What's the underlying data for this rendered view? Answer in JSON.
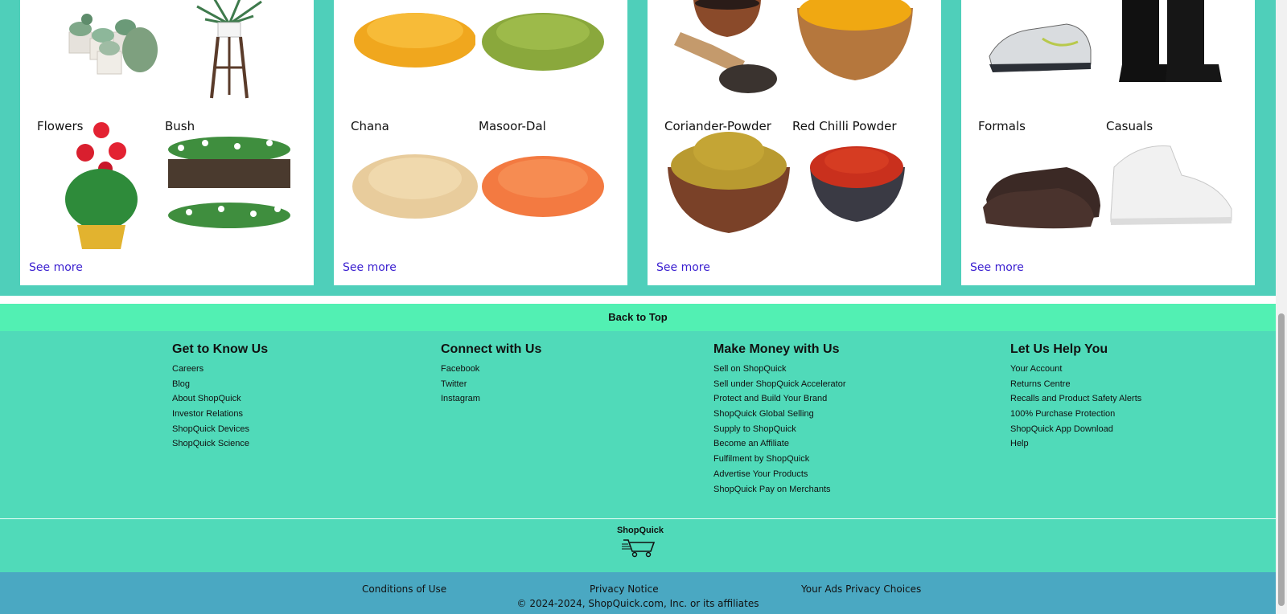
{
  "cards": [
    {
      "items": [
        {
          "label": "",
          "icon": "succulents-image"
        },
        {
          "label": "",
          "icon": "plant-stand-image"
        },
        {
          "label": "Flowers",
          "icon": "flowers-image"
        },
        {
          "label": "Bush",
          "icon": "bush-image"
        }
      ],
      "see_more": "See more"
    },
    {
      "items": [
        {
          "label": "",
          "icon": "yellow-lentils-image"
        },
        {
          "label": "",
          "icon": "green-gram-image"
        },
        {
          "label": "Chana",
          "icon": "chana-image"
        },
        {
          "label": "Masoor-Dal",
          "icon": "masoor-dal-image"
        }
      ],
      "see_more": "See more"
    },
    {
      "items": [
        {
          "label": "",
          "icon": "pepper-image"
        },
        {
          "label": "",
          "icon": "turmeric-image"
        },
        {
          "label": "Coriander-Powder",
          "icon": "coriander-powder-image"
        },
        {
          "label": "Red Chilli Powder",
          "icon": "red-chilli-powder-image"
        }
      ],
      "see_more": "See more"
    },
    {
      "items": [
        {
          "label": "",
          "icon": "sneakers-image"
        },
        {
          "label": "",
          "icon": "boots-image"
        },
        {
          "label": "Formals",
          "icon": "formal-shoes-image"
        },
        {
          "label": "Casuals",
          "icon": "casual-shoes-image"
        }
      ],
      "see_more": "See more"
    }
  ],
  "back_to_top": "Back to Top",
  "footer": {
    "columns": [
      {
        "title": "Get to Know Us",
        "links": [
          "Careers",
          "Blog",
          "About ShopQuick",
          "Investor Relations",
          "ShopQuick Devices",
          "ShopQuick Science"
        ]
      },
      {
        "title": "Connect with Us",
        "links": [
          "Facebook",
          "Twitter",
          "Instagram"
        ]
      },
      {
        "title": "Make Money with Us",
        "links": [
          "Sell on ShopQuick",
          "Sell under ShopQuick Accelerator",
          "Protect and Build Your Brand",
          "ShopQuick Global Selling",
          "Supply to ShopQuick",
          "Become an Affiliate",
          "Fulfilment by ShopQuick",
          "Advertise Your Products",
          "ShopQuick Pay on Merchants"
        ]
      },
      {
        "title": "Let Us Help You",
        "links": [
          "Your Account",
          "Returns Centre",
          "Recalls and Product Safety Alerts",
          "100% Purchase Protection",
          "ShopQuick App Download",
          "Help"
        ]
      }
    ],
    "logo_text": "ShopQuick"
  },
  "bottom": {
    "links": [
      "Conditions of Use",
      "Privacy Notice",
      "Your Ads Privacy Choices"
    ],
    "copyright": "© 2024-2024, ShopQuick.com, Inc. or its affiliates"
  },
  "colors": {
    "page_bg": "#4fcfba",
    "back_to_top_bg": "#52f0b3",
    "footer_bg": "#50dab9",
    "bottom_bar_bg": "#4aa8c2",
    "link_color": "#3a1fd0"
  }
}
